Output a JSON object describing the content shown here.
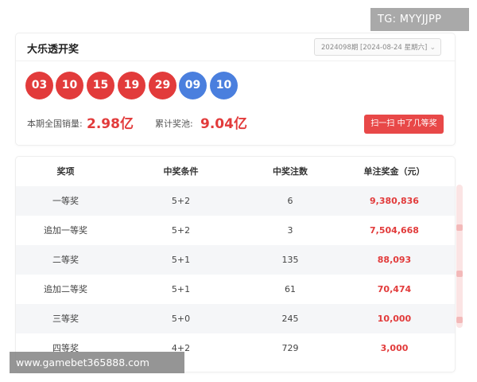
{
  "header": {
    "title": "大乐透开奖",
    "issue_select": "2024098期 [2024-08-24 星期六]"
  },
  "balls": {
    "red": [
      "03",
      "10",
      "15",
      "19",
      "29"
    ],
    "blue": [
      "09",
      "10"
    ]
  },
  "colors": {
    "red_ball": "#e23b3b",
    "blue_ball": "#4a7fde",
    "accent": "#e84848"
  },
  "stats": {
    "sales_label": "本期全国销量:",
    "sales_value": "2.98亿",
    "pool_label": "累计奖池:",
    "pool_value": "9.04亿"
  },
  "scan_button": "扫一扫 中了几等奖",
  "table": {
    "headers": [
      "奖项",
      "中奖条件",
      "中奖注数",
      "单注奖金（元）"
    ],
    "rows": [
      [
        "一等奖",
        "5+2",
        "6",
        "9,380,836"
      ],
      [
        "追加一等奖",
        "5+2",
        "3",
        "7,504,668"
      ],
      [
        "二等奖",
        "5+1",
        "135",
        "88,093"
      ],
      [
        "追加二等奖",
        "5+1",
        "61",
        "70,474"
      ],
      [
        "三等奖",
        "5+0",
        "245",
        "10,000"
      ],
      [
        "四等奖",
        "4+2",
        "729",
        "3,000"
      ]
    ]
  },
  "overlays": {
    "tg": "TG: MYYJJPP",
    "url": "www.gamebet365888.com"
  }
}
